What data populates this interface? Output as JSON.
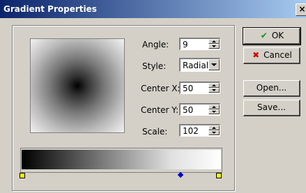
{
  "window": {
    "title": "Gradient Properties",
    "close_glyph": "×"
  },
  "fields": {
    "angle": {
      "label": "Angle:",
      "value": "9"
    },
    "style": {
      "label": "Style:",
      "value": "Radial"
    },
    "center_x": {
      "label": "Center X:",
      "value": "50"
    },
    "center_y": {
      "label": "Center Y:",
      "value": "50"
    },
    "scale": {
      "label": "Scale:",
      "value": "102"
    }
  },
  "buttons": {
    "ok": {
      "label": "OK",
      "icon": "check-icon"
    },
    "cancel": {
      "label": "Cancel",
      "icon": "x-icon"
    },
    "open": {
      "label": "Open..."
    },
    "save": {
      "label": "Save..."
    }
  },
  "gradient": {
    "type": "radial",
    "colors": {
      "start": "#000000",
      "end": "#ffffff",
      "stop_marker": "#ffff00",
      "midpoint_marker": "#0000cc"
    }
  }
}
